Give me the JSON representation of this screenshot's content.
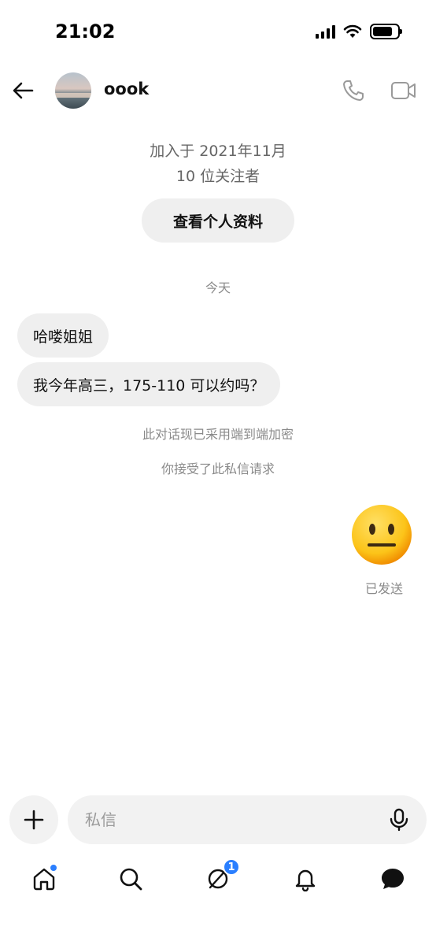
{
  "status_bar": {
    "time": "21:02"
  },
  "header": {
    "username": "oook"
  },
  "profile": {
    "joined": "加入于 2021年11月",
    "followers": "10 位关注者",
    "view_profile_label": "查看个人资料"
  },
  "conversation": {
    "date_separator": "今天",
    "received_messages": [
      "哈喽姐姐",
      "我今年高三，175-110 可以约吗？"
    ],
    "encryption_note": "此对话现已采用端到端加密",
    "request_note": "你接受了此私信请求",
    "sent_message": {
      "emoji": "neutral-face",
      "status": "已发送"
    }
  },
  "composer": {
    "placeholder": "私信"
  },
  "bottom_nav": {
    "items": [
      {
        "name": "home",
        "icon": "home-icon",
        "has_dot": true
      },
      {
        "name": "search",
        "icon": "search-icon"
      },
      {
        "name": "threads",
        "icon": "threads-icon",
        "badge": "1"
      },
      {
        "name": "notifications",
        "icon": "bell-icon"
      },
      {
        "name": "messages",
        "icon": "chat-bubble-icon"
      }
    ]
  },
  "colors": {
    "accent": "#2a7fff",
    "bubble_bg": "#efefef",
    "muted_text": "#8a8a8a",
    "emoji_yellow": "#fcc419"
  }
}
